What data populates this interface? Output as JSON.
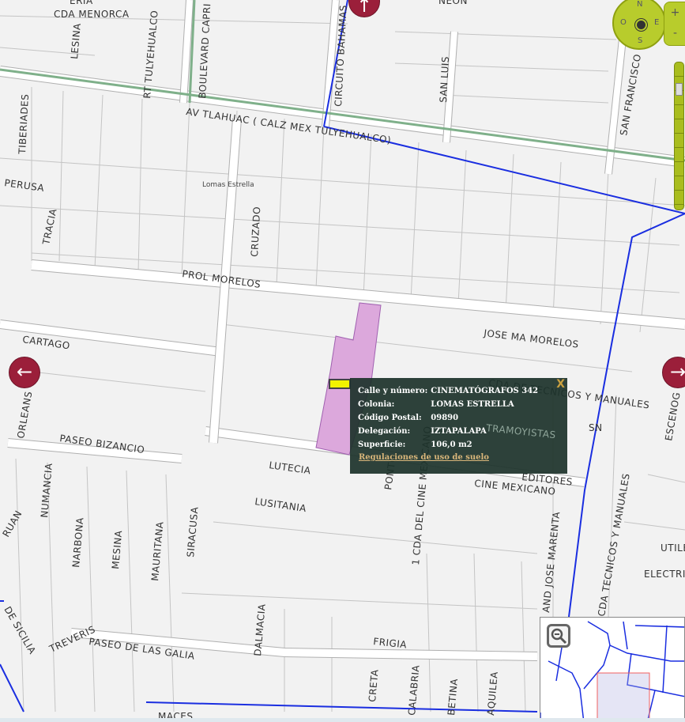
{
  "map": {
    "streets": [
      "CDA MENORCA",
      "LESINA",
      "RT TULYEHUALCO",
      "BOULEVARD CAPRI",
      "CIRCUITO BAHAMAS",
      "SAN LUIS",
      "SAN FRANCISCO",
      "AV TLAHUAC ( CALZ MEX TULYEHUALCO)",
      "TIBERIADES",
      "PERUSA",
      "TRACIA",
      "CRUZADO",
      "PROL MORELOS",
      "JOSE MA MORELOS",
      "CARTAGO",
      "ORLEANS",
      "PASEO BIZANCIO",
      "LUTECIA",
      "LUSITANIA",
      "CINE MEXICANO",
      "PONTO",
      "1 CDA DEL CINE MEXICANO",
      "AND JOSE MARENTA",
      "CDA TECNICOS Y MANUALES",
      "CDA DE TECNICOS Y MANUALES",
      "TRAMOYISTAS",
      "EDITORES",
      "SN",
      "ESCENOG",
      "UTILE",
      "ELECTRI",
      "NUMANCIA",
      "NARBONA",
      "MESINA",
      "MAURITANA",
      "SIRACUSA",
      "RUAN",
      "TREVERIS",
      "PASEO DE LAS GALIA",
      "DE SICILIA",
      "DALMACIA",
      "FRIGIA",
      "CRETA",
      "CALABRIA",
      "BETINA",
      "AQUILEA",
      "MACES",
      "NEON",
      "ERIA"
    ],
    "neighborhood_label": "Lomas Estrella",
    "parcel_color": "#dca8dc",
    "road_color_blue": "#1a2ee0",
    "road_color_green": "#7fb08a"
  },
  "popup": {
    "rows": [
      {
        "key": "Calle y número:",
        "value": "CINEMATÓGRAFOS 342"
      },
      {
        "key": "Colonia:",
        "value": "LOMAS ESTRELLA"
      },
      {
        "key": "Código Postal:",
        "value": "09890"
      },
      {
        "key": "Delegación:",
        "value": "IZTAPALAPA"
      },
      {
        "key": "Superficie:",
        "value": "106,0 m2"
      }
    ],
    "link": "Regulaciones de uso de suelo",
    "close": "X"
  },
  "compass": {
    "n": "N",
    "s": "S",
    "e": "E",
    "w": "O"
  },
  "zoom": {
    "in": "+",
    "out": "-",
    "level_fraction": 0.15
  },
  "nav": {
    "left": "←",
    "right": "→",
    "up": "↑"
  }
}
